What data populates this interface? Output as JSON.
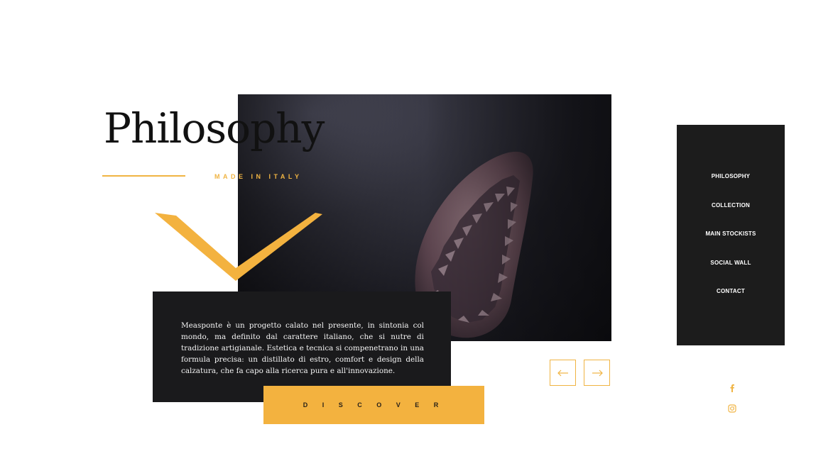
{
  "hero": {
    "title": "Philosophy",
    "subtitle": "MADE IN ITALY",
    "image_subject": "shoe-sole-image"
  },
  "card": {
    "text": "Measponte è un progetto calato nel presente, in sintonia col mondo, ma definito dal carattere italiano, che si nutre di tradizione artigianale. Estetica e tecnica si compenetrano in una formula precisa: un distillato di estro, comfort e design della calzatura, che fa capo alla ricerca pura e all'innovazione.",
    "button_label": "D I S C O V E R"
  },
  "slider": {
    "prev_icon": "arrow-left-icon",
    "next_icon": "arrow-right-icon"
  },
  "nav": {
    "items": [
      {
        "label": "PHILOSOPHY"
      },
      {
        "label": "COLLECTION"
      },
      {
        "label": "MAIN STOCKISTS"
      },
      {
        "label": "SOCIAL WALL"
      },
      {
        "label": "CONTACT"
      }
    ]
  },
  "social": {
    "facebook_icon": "facebook-icon",
    "instagram_icon": "instagram-icon"
  },
  "colors": {
    "accent": "#f0b443",
    "dark": "#1a1a1c",
    "background": "#ffffff"
  }
}
